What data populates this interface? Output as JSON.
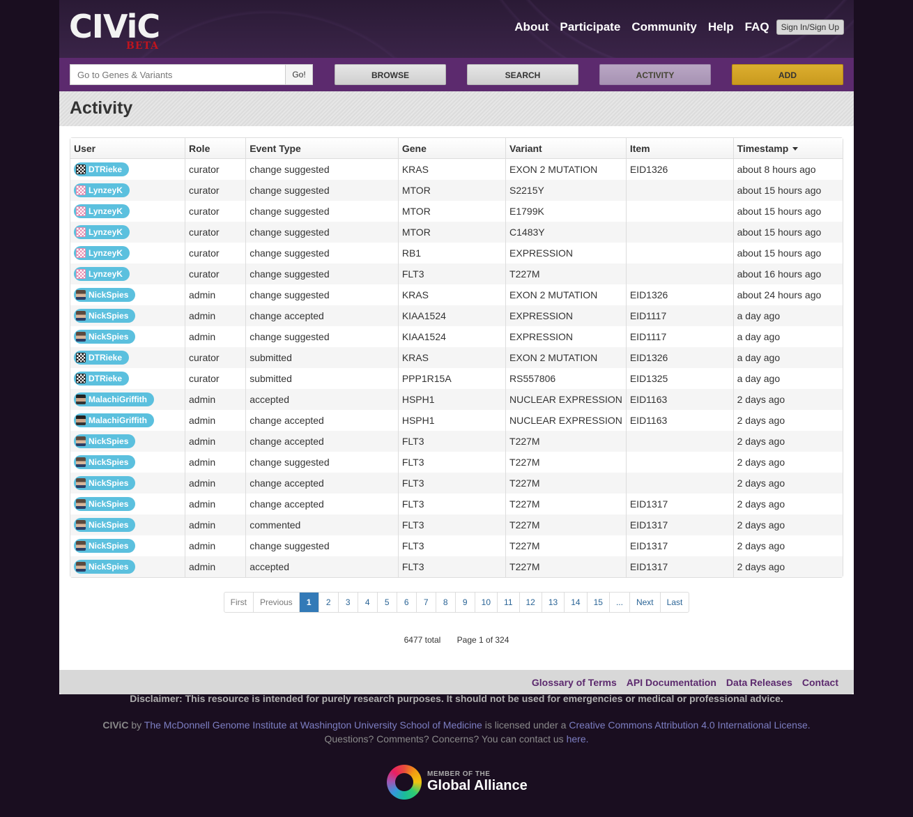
{
  "header": {
    "logo": "CIViC",
    "logo_badge": "BETA",
    "nav": [
      "About",
      "Participate",
      "Community",
      "Help",
      "FAQ"
    ],
    "signin_label": "Sign In/Sign Up"
  },
  "toolbar": {
    "search_placeholder": "Go to Genes & Variants",
    "go_label": "Go!",
    "browse_label": "BROWSE",
    "search_label": "SEARCH",
    "activity_label": "ACTIVITY",
    "add_label": "ADD"
  },
  "page": {
    "title": "Activity"
  },
  "table": {
    "columns": [
      "User",
      "Role",
      "Event Type",
      "Gene",
      "Variant",
      "Item",
      "Timestamp"
    ],
    "rows": [
      {
        "user": "DTRieke",
        "avatar": "dt",
        "role": "curator",
        "event": "change suggested",
        "gene": "KRAS",
        "variant": "EXON 2 MUTATION",
        "item": "EID1326",
        "time": "about 8 hours ago"
      },
      {
        "user": "LynzeyK",
        "avatar": "ly",
        "role": "curator",
        "event": "change suggested",
        "gene": "MTOR",
        "variant": "S2215Y",
        "item": "",
        "time": "about 15 hours ago"
      },
      {
        "user": "LynzeyK",
        "avatar": "ly",
        "role": "curator",
        "event": "change suggested",
        "gene": "MTOR",
        "variant": "E1799K",
        "item": "",
        "time": "about 15 hours ago"
      },
      {
        "user": "LynzeyK",
        "avatar": "ly",
        "role": "curator",
        "event": "change suggested",
        "gene": "MTOR",
        "variant": "C1483Y",
        "item": "",
        "time": "about 15 hours ago"
      },
      {
        "user": "LynzeyK",
        "avatar": "ly",
        "role": "curator",
        "event": "change suggested",
        "gene": "RB1",
        "variant": "EXPRESSION",
        "item": "",
        "time": "about 15 hours ago"
      },
      {
        "user": "LynzeyK",
        "avatar": "ly",
        "role": "curator",
        "event": "change suggested",
        "gene": "FLT3",
        "variant": "T227M",
        "item": "",
        "time": "about 16 hours ago"
      },
      {
        "user": "NickSpies",
        "avatar": "ni",
        "role": "admin",
        "event": "change suggested",
        "gene": "KRAS",
        "variant": "EXON 2 MUTATION",
        "item": "EID1326",
        "time": "about 24 hours ago"
      },
      {
        "user": "NickSpies",
        "avatar": "ni",
        "role": "admin",
        "event": "change accepted",
        "gene": "KIAA1524",
        "variant": "EXPRESSION",
        "item": "EID1117",
        "time": "a day ago"
      },
      {
        "user": "NickSpies",
        "avatar": "ni",
        "role": "admin",
        "event": "change suggested",
        "gene": "KIAA1524",
        "variant": "EXPRESSION",
        "item": "EID1117",
        "time": "a day ago"
      },
      {
        "user": "DTRieke",
        "avatar": "dt",
        "role": "curator",
        "event": "submitted",
        "gene": "KRAS",
        "variant": "EXON 2 MUTATION",
        "item": "EID1326",
        "time": "a day ago"
      },
      {
        "user": "DTRieke",
        "avatar": "dt",
        "role": "curator",
        "event": "submitted",
        "gene": "PPP1R15A",
        "variant": "RS557806",
        "item": "EID1325",
        "time": "a day ago"
      },
      {
        "user": "MalachiGriffith",
        "avatar": "ma",
        "role": "admin",
        "event": "accepted",
        "gene": "HSPH1",
        "variant": "NUCLEAR EXPRESSION",
        "item": "EID1163",
        "time": "2 days ago"
      },
      {
        "user": "MalachiGriffith",
        "avatar": "ma",
        "role": "admin",
        "event": "change accepted",
        "gene": "HSPH1",
        "variant": "NUCLEAR EXPRESSION",
        "item": "EID1163",
        "time": "2 days ago"
      },
      {
        "user": "NickSpies",
        "avatar": "ni",
        "role": "admin",
        "event": "change accepted",
        "gene": "FLT3",
        "variant": "T227M",
        "item": "",
        "time": "2 days ago"
      },
      {
        "user": "NickSpies",
        "avatar": "ni",
        "role": "admin",
        "event": "change suggested",
        "gene": "FLT3",
        "variant": "T227M",
        "item": "",
        "time": "2 days ago"
      },
      {
        "user": "NickSpies",
        "avatar": "ni",
        "role": "admin",
        "event": "change accepted",
        "gene": "FLT3",
        "variant": "T227M",
        "item": "",
        "time": "2 days ago"
      },
      {
        "user": "NickSpies",
        "avatar": "ni",
        "role": "admin",
        "event": "change accepted",
        "gene": "FLT3",
        "variant": "T227M",
        "item": "EID1317",
        "time": "2 days ago"
      },
      {
        "user": "NickSpies",
        "avatar": "ni",
        "role": "admin",
        "event": "commented",
        "gene": "FLT3",
        "variant": "T227M",
        "item": "EID1317",
        "time": "2 days ago"
      },
      {
        "user": "NickSpies",
        "avatar": "ni",
        "role": "admin",
        "event": "change suggested",
        "gene": "FLT3",
        "variant": "T227M",
        "item": "EID1317",
        "time": "2 days ago"
      },
      {
        "user": "NickSpies",
        "avatar": "ni",
        "role": "admin",
        "event": "accepted",
        "gene": "FLT3",
        "variant": "T227M",
        "item": "EID1317",
        "time": "2 days ago"
      }
    ]
  },
  "pagination": {
    "first": "First",
    "previous": "Previous",
    "pages": [
      "1",
      "2",
      "3",
      "4",
      "5",
      "6",
      "7",
      "8",
      "9",
      "10",
      "11",
      "12",
      "13",
      "14",
      "15"
    ],
    "active": "1",
    "ellipsis": "...",
    "next": "Next",
    "last": "Last",
    "total": "6477 total",
    "page_info": "Page 1 of 324"
  },
  "footer": {
    "links": [
      "Glossary of Terms",
      "API Documentation",
      "Data Releases",
      "Contact"
    ],
    "disclaimer": "Disclaimer: This resource is intended for purely research purposes. It should not be used for emergencies or medical or professional advice.",
    "license_brand": "CIViC",
    "license_by": "by",
    "license_org": "The McDonnell Genome Institute at Washington University School of Medicine",
    "license_mid": "is licensed under a",
    "license_name": "Creative Commons Attribution 4.0 International License",
    "license_end": ".",
    "contact_text": "Questions? Comments? Concerns? You can contact us",
    "contact_link": "here",
    "contact_end": ".",
    "ga_small": "MEMBER OF THE",
    "ga_big": "Global Alliance"
  },
  "colors": {
    "brand_purple": "#5c2a6e",
    "user_pill": "#5bc0de",
    "add_button": "#d4a62a",
    "active_page": "#337ab7"
  }
}
